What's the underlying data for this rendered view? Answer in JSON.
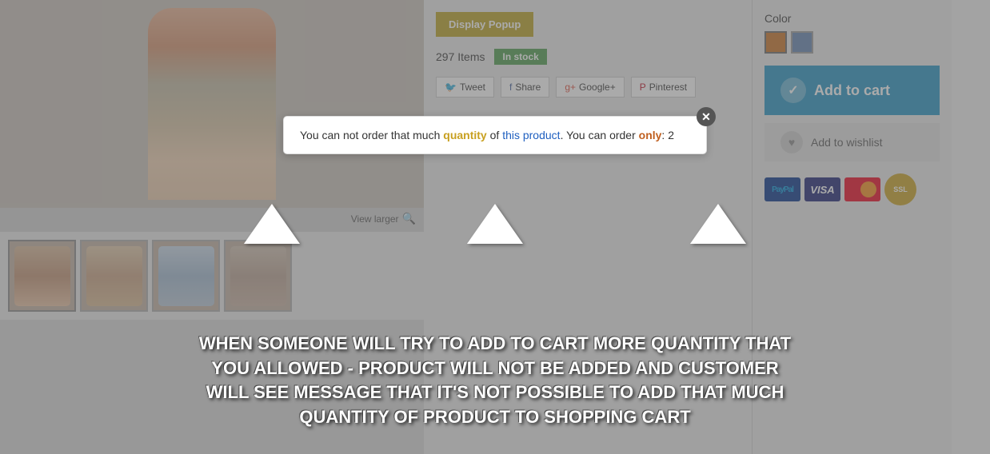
{
  "product": {
    "display_popup_label": "Display Popup",
    "items_count": "297 Items",
    "in_stock_label": "In stock",
    "view_larger_label": "View larger"
  },
  "social": {
    "tweet_label": "Tweet",
    "facebook_label": "Share",
    "googleplus_label": "Google+",
    "pinterest_label": "Pinterest"
  },
  "sidebar": {
    "color_label": "Color",
    "add_to_cart_label": "Add to cart",
    "add_to_wishlist_label": "Add to wishlist"
  },
  "payment": {
    "paypal_label": "PayPal",
    "visa_label": "VISA",
    "mastercard_label": "MC",
    "ssl_label": "SSL"
  },
  "popup": {
    "message_part1": "You can not order that much",
    "message_highlight": "quantity",
    "message_part2": "of",
    "message_link": "this product",
    "message_part3": ". You can order",
    "message_only": "only",
    "message_number": ": 2"
  },
  "overlay_text": {
    "line1": "WHEN SOMEONE WILL TRY TO ADD TO CART MORE QUANTITY THAT",
    "line2": "YOU ALLOWED  - PRODUCT WILL NOT BE ADDED AND CUSTOMER",
    "line3": "WILL SEE MESSAGE THAT IT'S NOT POSSIBLE TO ADD THAT MUCH",
    "line4": "QUANTITY OF PRODUCT TO SHOPPING CART"
  }
}
